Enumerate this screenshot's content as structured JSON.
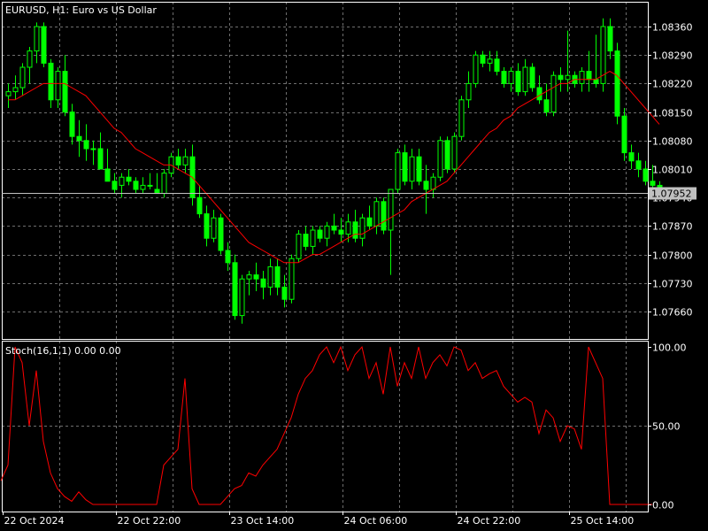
{
  "header": {
    "price_title": "EURUSD, H1:  Euro vs US Dollar",
    "stoch_title": "Stoch(16,1,1) 0.00 0.00"
  },
  "colors": {
    "background": "#000000",
    "grid": "#c8c8c8",
    "bull_candle": "#ffffff",
    "bear_candle": "#00ff00",
    "wick": "#00ff00",
    "moving_average": "#ff0000",
    "stochastic": "#ff0000",
    "bid_line": "#c0c0c0",
    "price_tag_bg": "#c0c0c0",
    "price_tag_text": "#000000"
  },
  "chart_data": [
    {
      "type": "candlestick",
      "symbol": "EURUSD",
      "timeframe": "H1",
      "ylim": [
        1.076,
        1.0838
      ],
      "y_ticks": [
        "1.08360",
        "1.08290",
        "1.08220",
        "1.08150",
        "1.08080",
        "1.08010",
        "1.07940",
        "1.07870",
        "1.07800",
        "1.07730",
        "1.07660"
      ],
      "current_price": "1.07952",
      "x_labels": [
        "22 Oct 2024",
        "22 Oct 22:00",
        "23 Oct 14:00",
        "24 Oct 06:00",
        "24 Oct 22:00",
        "25 Oct 14:00"
      ],
      "x_label_bar_index": [
        0,
        16,
        32,
        48,
        64,
        80
      ],
      "grid": true,
      "candles": [
        [
          1.0819,
          1.0822,
          1.0816,
          1.082
        ],
        [
          1.082,
          1.0824,
          1.0818,
          1.0821
        ],
        [
          1.0821,
          1.0827,
          1.0819,
          1.0826
        ],
        [
          1.0826,
          1.0831,
          1.0822,
          1.083
        ],
        [
          1.083,
          1.0837,
          1.0827,
          1.0836
        ],
        [
          1.0836,
          1.0837,
          1.0826,
          1.0827
        ],
        [
          1.0827,
          1.0828,
          1.0816,
          1.0818
        ],
        [
          1.0818,
          1.0826,
          1.0816,
          1.0825
        ],
        [
          1.0825,
          1.0829,
          1.0814,
          1.0815
        ],
        [
          1.0815,
          1.0817,
          1.0807,
          1.0809
        ],
        [
          1.0809,
          1.0813,
          1.0804,
          1.0808
        ],
        [
          1.0808,
          1.0812,
          1.0803,
          1.0806
        ],
        [
          1.0806,
          1.0808,
          1.0802,
          1.0806
        ],
        [
          1.0806,
          1.081,
          1.0805,
          1.0801
        ],
        [
          1.0801,
          1.0806,
          1.0798,
          1.0798
        ],
        [
          1.0798,
          1.08,
          1.0795,
          1.0796
        ],
        [
          1.0797,
          1.08,
          1.0794,
          1.0799
        ],
        [
          1.0799,
          1.0801,
          1.0797,
          1.0798
        ],
        [
          1.0798,
          1.0799,
          1.0795,
          1.0796
        ],
        [
          1.0796,
          1.0799,
          1.0795,
          1.0797
        ],
        [
          1.0797,
          1.08,
          1.0796,
          1.0797
        ],
        [
          1.0796,
          1.08,
          1.0795,
          1.0795
        ],
        [
          1.0795,
          1.0801,
          1.0794,
          1.08
        ],
        [
          1.08,
          1.0805,
          1.0799,
          1.0804
        ],
        [
          1.0804,
          1.0806,
          1.0801,
          1.0802
        ],
        [
          1.0802,
          1.0806,
          1.08,
          1.0804
        ],
        [
          1.0804,
          1.0807,
          1.0792,
          1.0794
        ],
        [
          1.0794,
          1.0797,
          1.0789,
          1.079
        ],
        [
          1.079,
          1.0792,
          1.0782,
          1.0784
        ],
        [
          1.0784,
          1.0791,
          1.0783,
          1.0789
        ],
        [
          1.0789,
          1.079,
          1.078,
          1.0781
        ],
        [
          1.0781,
          1.0783,
          1.0776,
          1.0778
        ],
        [
          1.0778,
          1.078,
          1.0764,
          1.0765
        ],
        [
          1.0765,
          1.0775,
          1.0763,
          1.0774
        ],
        [
          1.0774,
          1.0776,
          1.077,
          1.0775
        ],
        [
          1.0775,
          1.0778,
          1.0771,
          1.0774
        ],
        [
          1.0774,
          1.0776,
          1.0769,
          1.0772
        ],
        [
          1.0772,
          1.0779,
          1.077,
          1.0777
        ],
        [
          1.0777,
          1.0779,
          1.077,
          1.0772
        ],
        [
          1.0772,
          1.0775,
          1.0767,
          1.0769
        ],
        [
          1.0769,
          1.078,
          1.0768,
          1.0779
        ],
        [
          1.0779,
          1.0786,
          1.0778,
          1.0785
        ],
        [
          1.0785,
          1.0787,
          1.0781,
          1.0782
        ],
        [
          1.0782,
          1.0787,
          1.078,
          1.0786
        ],
        [
          1.0786,
          1.0787,
          1.0783,
          1.0784
        ],
        [
          1.0784,
          1.0788,
          1.0782,
          1.0787
        ],
        [
          1.0787,
          1.079,
          1.0785,
          1.0786
        ],
        [
          1.0786,
          1.0789,
          1.0783,
          1.0785
        ],
        [
          1.0785,
          1.079,
          1.0783,
          1.0788
        ],
        [
          1.0788,
          1.0791,
          1.0783,
          1.0784
        ],
        [
          1.0784,
          1.079,
          1.0782,
          1.0789
        ],
        [
          1.0789,
          1.0792,
          1.0786,
          1.0787
        ],
        [
          1.0787,
          1.0794,
          1.0785,
          1.0793
        ],
        [
          1.0793,
          1.0794,
          1.0785,
          1.0786
        ],
        [
          1.0786,
          1.0796,
          1.0775,
          1.0796
        ],
        [
          1.0796,
          1.0806,
          1.0795,
          1.0805
        ],
        [
          1.0805,
          1.0807,
          1.0797,
          1.0798
        ],
        [
          1.0798,
          1.0806,
          1.0796,
          1.0804
        ],
        [
          1.0804,
          1.0806,
          1.0797,
          1.0798
        ],
        [
          1.0798,
          1.0802,
          1.079,
          1.0796
        ],
        [
          1.0796,
          1.08,
          1.0794,
          1.0799
        ],
        [
          1.0799,
          1.0809,
          1.0798,
          1.0808
        ],
        [
          1.0808,
          1.0809,
          1.08,
          1.0801
        ],
        [
          1.0801,
          1.081,
          1.08,
          1.0809
        ],
        [
          1.0809,
          1.0819,
          1.0808,
          1.0818
        ],
        [
          1.0818,
          1.0825,
          1.0816,
          1.0822
        ],
        [
          1.0822,
          1.083,
          1.0821,
          1.0829
        ],
        [
          1.0829,
          1.083,
          1.0826,
          1.0827
        ],
        [
          1.0827,
          1.083,
          1.0825,
          1.0828
        ],
        [
          1.0828,
          1.083,
          1.0824,
          1.0825
        ],
        [
          1.0825,
          1.0826,
          1.0821,
          1.0822
        ],
        [
          1.0822,
          1.0826,
          1.082,
          1.0825
        ],
        [
          1.0825,
          1.0827,
          1.0819,
          1.082
        ],
        [
          1.082,
          1.0828,
          1.0819,
          1.0826
        ],
        [
          1.0826,
          1.0827,
          1.082,
          1.0821
        ],
        [
          1.0821,
          1.0824,
          1.0817,
          1.0818
        ],
        [
          1.0818,
          1.0822,
          1.0814,
          1.0815
        ],
        [
          1.0815,
          1.0825,
          1.0814,
          1.0824
        ],
        [
          1.0824,
          1.0826,
          1.082,
          1.0823
        ],
        [
          1.0823,
          1.0835,
          1.082,
          1.0824
        ],
        [
          1.0824,
          1.0825,
          1.0821,
          1.0822
        ],
        [
          1.0822,
          1.0826,
          1.082,
          1.0825
        ],
        [
          1.0825,
          1.083,
          1.082,
          1.0823
        ],
        [
          1.0823,
          1.0834,
          1.0821,
          1.0822
        ],
        [
          1.0822,
          1.0838,
          1.082,
          1.0836
        ],
        [
          1.0836,
          1.0838,
          1.0828,
          1.083
        ],
        [
          1.083,
          1.0832,
          1.0812,
          1.0814
        ],
        [
          1.0814,
          1.0816,
          1.0803,
          1.0805
        ],
        [
          1.0805,
          1.0807,
          1.0801,
          1.0803
        ],
        [
          1.0803,
          1.0805,
          1.0799,
          1.0801
        ],
        [
          1.0801,
          1.0803,
          1.0797,
          1.0798
        ],
        [
          1.0798,
          1.0802,
          1.0795,
          1.0797
        ],
        [
          1.0797,
          1.0798,
          1.0794,
          1.0796
        ]
      ],
      "moving_average": [
        1.0818,
        1.0818,
        1.0819,
        1.082,
        1.0821,
        1.0822,
        1.0822,
        1.0822,
        1.0822,
        1.0821,
        1.082,
        1.0819,
        1.0817,
        1.0815,
        1.0813,
        1.0811,
        1.081,
        1.0808,
        1.0806,
        1.0805,
        1.0804,
        1.0803,
        1.0802,
        1.0802,
        1.0801,
        1.08,
        1.0799,
        1.0797,
        1.0795,
        1.0793,
        1.0791,
        1.0789,
        1.0787,
        1.0785,
        1.0783,
        1.0782,
        1.0781,
        1.078,
        1.0779,
        1.0778,
        1.0778,
        1.0778,
        1.0779,
        1.078,
        1.078,
        1.0781,
        1.0782,
        1.0783,
        1.0784,
        1.0785,
        1.0785,
        1.0786,
        1.0787,
        1.0788,
        1.0789,
        1.079,
        1.0791,
        1.0793,
        1.0794,
        1.0795,
        1.0796,
        1.0797,
        1.0798,
        1.08,
        1.0802,
        1.0804,
        1.0806,
        1.0808,
        1.081,
        1.0811,
        1.0813,
        1.0814,
        1.0816,
        1.0817,
        1.0818,
        1.0819,
        1.082,
        1.0821,
        1.0822,
        1.0822,
        1.0823,
        1.0823,
        1.0823,
        1.0823,
        1.0824,
        1.0825,
        1.0824,
        1.0822,
        1.082,
        1.0818,
        1.0816,
        1.0814,
        1.0812
      ]
    },
    {
      "type": "line",
      "title": "Stoch(16,1,1) 0.00 0.00",
      "ylim": [
        0,
        100
      ],
      "y_ticks": [
        "100.00",
        "50.00",
        "0.00"
      ],
      "series": [
        {
          "values": [
            15,
            25,
            100,
            90,
            50,
            85,
            40,
            20,
            10,
            5,
            2,
            8,
            3,
            0,
            0,
            0,
            0,
            0,
            0,
            0,
            0,
            0,
            0,
            25,
            30,
            35,
            80,
            10,
            0,
            0,
            0,
            0,
            5,
            10,
            12,
            20,
            18,
            25,
            30,
            35,
            45,
            55,
            70,
            80,
            85,
            95,
            100,
            90,
            100,
            85,
            95,
            100,
            80,
            90,
            70,
            100,
            75,
            90,
            80,
            100,
            80,
            90,
            95,
            88,
            100,
            98,
            85,
            90,
            80,
            83,
            85,
            75,
            70,
            65,
            68,
            65,
            45,
            60,
            55,
            40,
            50,
            48,
            35,
            100,
            90,
            80,
            0,
            0,
            0,
            0,
            0,
            0,
            0
          ]
        }
      ]
    }
  ]
}
